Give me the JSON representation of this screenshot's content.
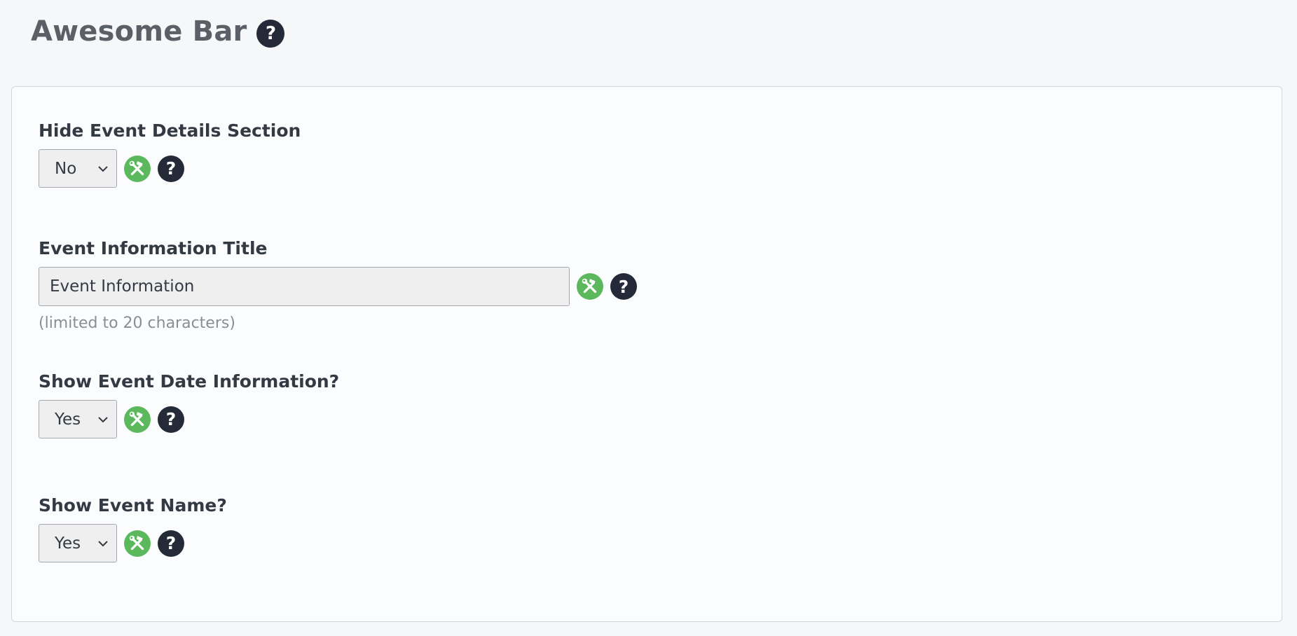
{
  "header": {
    "title": "Awesome Bar",
    "help_icon": "question-circle-icon"
  },
  "icons": {
    "tools": "hammer-wrench-icon",
    "help": "question-circle-icon",
    "help_glyph": "?"
  },
  "colors": {
    "tools_icon_bg": "#5cb85c",
    "help_icon_bg": "#242a38"
  },
  "fields": [
    {
      "label": "Hide Event Details Section",
      "type": "select",
      "value": "No"
    },
    {
      "label": "Event Information Title",
      "type": "text",
      "value": "Event Information",
      "hint": "(limited to 20 characters)"
    },
    {
      "label": "Show Event Date Information?",
      "type": "select",
      "value": "Yes"
    },
    {
      "label": "Show Event Name?",
      "type": "select",
      "value": "Yes"
    }
  ]
}
